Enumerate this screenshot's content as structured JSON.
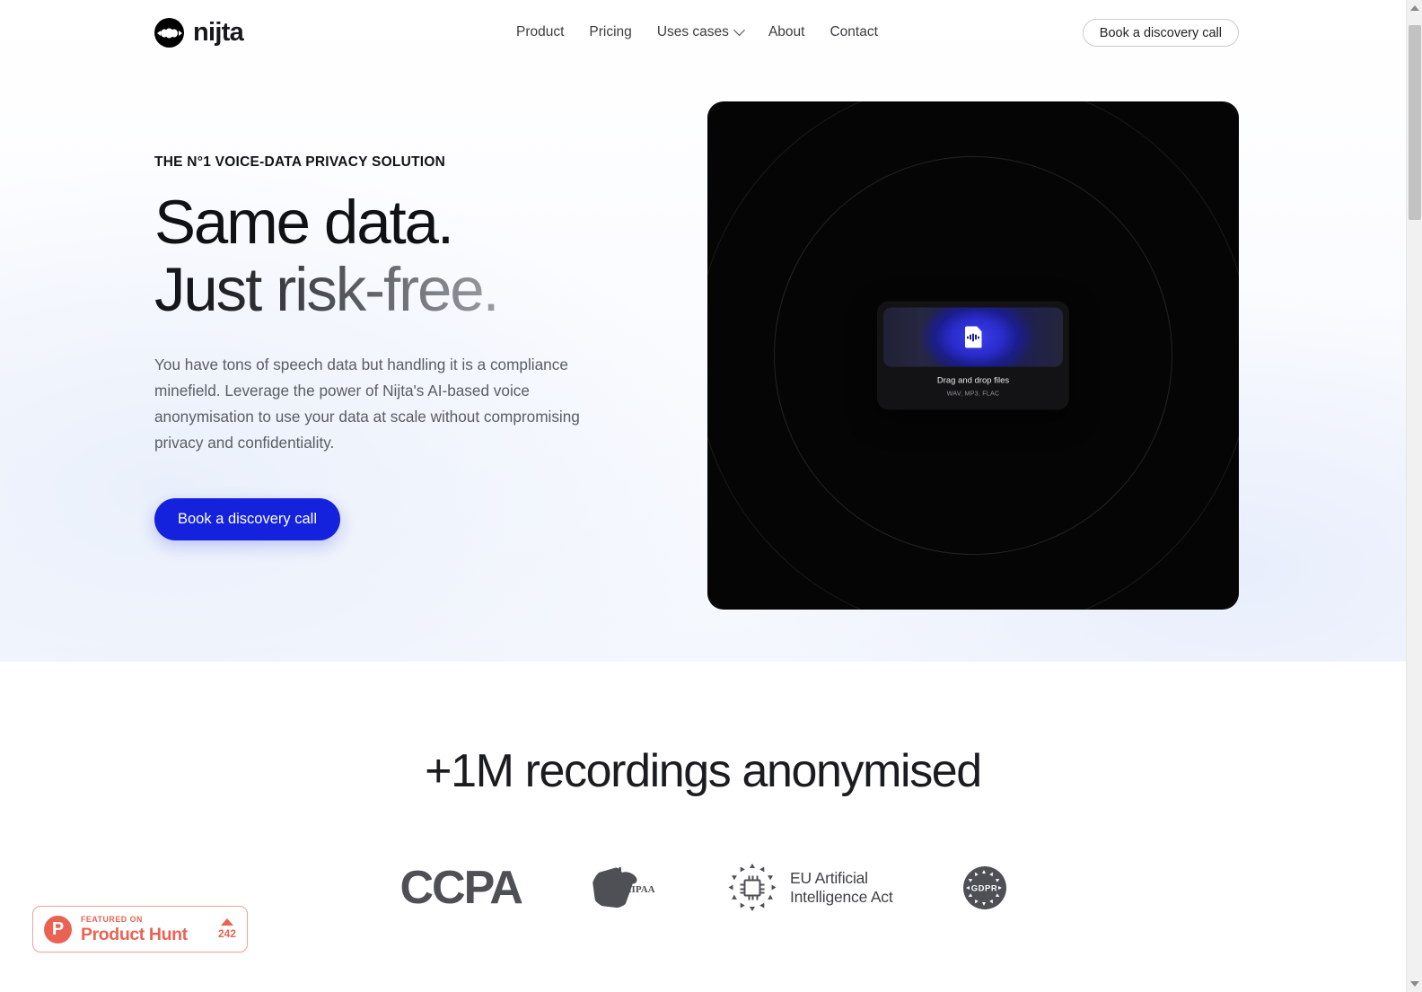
{
  "brand": {
    "name": "nijta",
    "logo_icon": "nijta-waveform-circle-icon"
  },
  "header": {
    "nav": [
      {
        "label": "Product",
        "has_dropdown": false
      },
      {
        "label": "Pricing",
        "has_dropdown": false
      },
      {
        "label": "Uses cases",
        "has_dropdown": true
      },
      {
        "label": "About",
        "has_dropdown": false
      },
      {
        "label": "Contact",
        "has_dropdown": false
      }
    ],
    "cta_label": "Book a discovery call"
  },
  "hero": {
    "eyebrow": "THE N°1 VOICE-DATA PRIVACY SOLUTION",
    "headline_line1": "Same data.",
    "headline_line2": "Just risk-free.",
    "paragraph": "You have tons of speech data but handling it is a compliance minefield. Leverage the power of Nijta's AI-based voice anonymisation to use your data at scale without compromising privacy and confidentiality.",
    "cta_label": "Book a discovery call",
    "cta_color": "#1422dd",
    "panel": {
      "background_color": "#050505",
      "dropzone_title": "Drag and drop files",
      "dropzone_subtitle": "WAV, MP3, FLAC",
      "dropzone_icon": "audio-file-icon"
    }
  },
  "proof": {
    "title": "+1M recordings anonymised",
    "logos": [
      {
        "name": "CCPA",
        "label": "CCPA"
      },
      {
        "name": "HIPAA",
        "label": "HIPAA"
      },
      {
        "name": "EU Artificial Intelligence Act",
        "label_line1": "EU Artificial",
        "label_line2": "Intelligence Act"
      },
      {
        "name": "GDPR",
        "label": "GDPR"
      }
    ]
  },
  "product_hunt": {
    "featured_label": "FEATURED ON",
    "name": "Product Hunt",
    "upvotes": "242",
    "initial": "P",
    "accent_color": "#ea6352"
  }
}
